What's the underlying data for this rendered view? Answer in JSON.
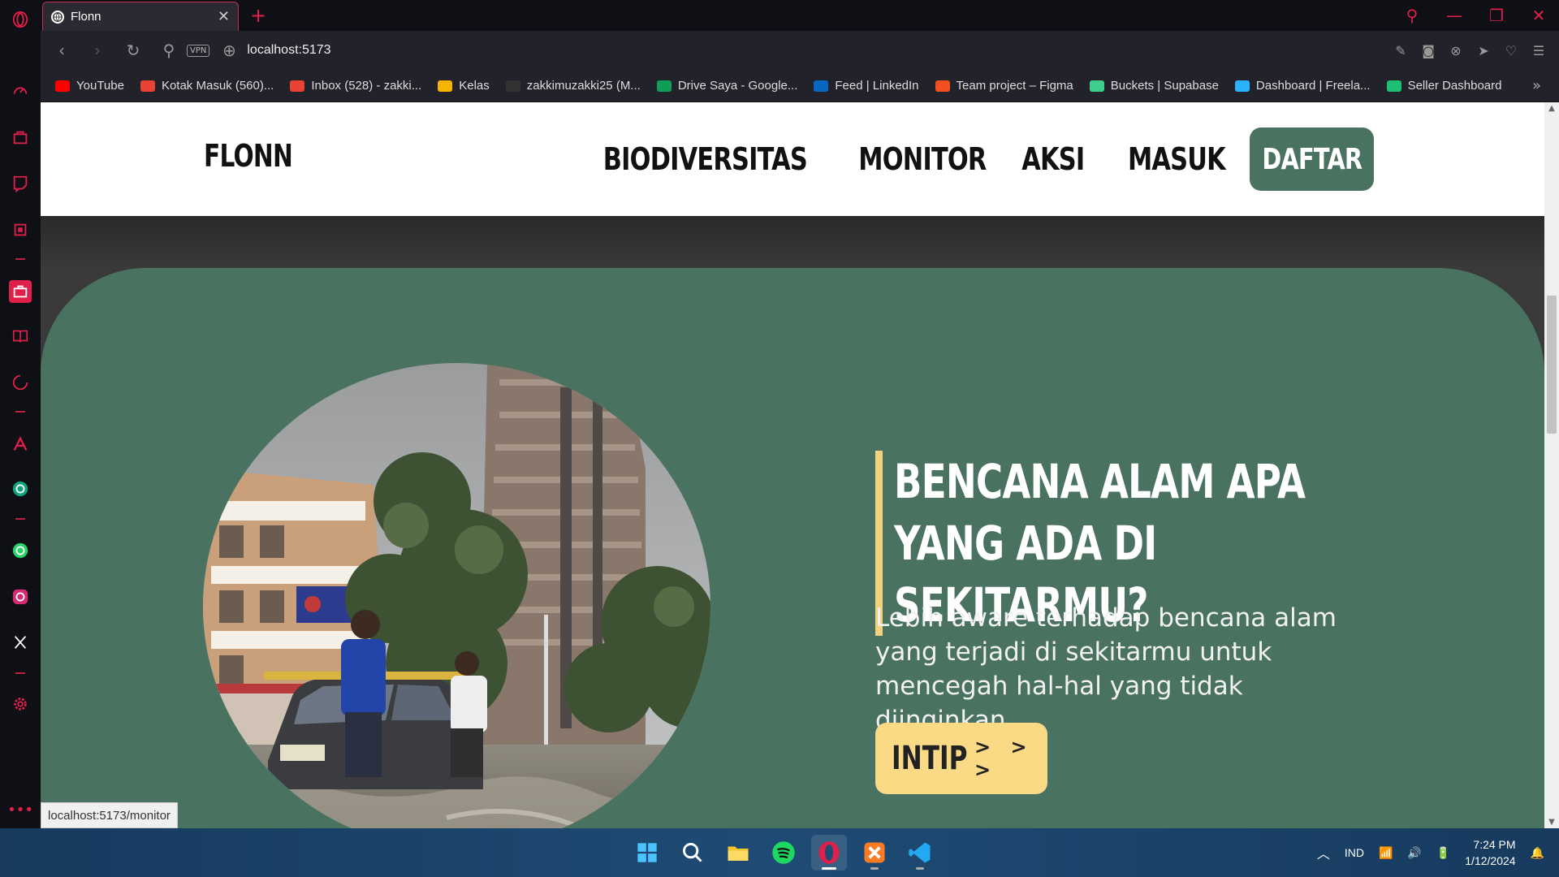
{
  "browser": {
    "tab_title": "Flonn",
    "url": "localhost:5173",
    "vpn_badge": "VPN",
    "status_url": "localhost:5173/monitor",
    "accent_color": "#e0204a"
  },
  "bookmarks": [
    {
      "label": "YouTube",
      "icon": "youtube-icon",
      "color": "#ff0000"
    },
    {
      "label": "Kotak Masuk (560)...",
      "icon": "gmail-icon",
      "color": "#ea4335"
    },
    {
      "label": "Inbox (528) - zakki...",
      "icon": "gmail-icon",
      "color": "#ea4335"
    },
    {
      "label": "Kelas",
      "icon": "classroom-icon",
      "color": "#f4b400"
    },
    {
      "label": "zakkimuzakki25 (M...",
      "icon": "github-icon",
      "color": "#333333"
    },
    {
      "label": "Drive Saya - Google...",
      "icon": "drive-icon",
      "color": "#0f9d58"
    },
    {
      "label": "Feed | LinkedIn",
      "icon": "linkedin-icon",
      "color": "#0a66c2"
    },
    {
      "label": "Team project – Figma",
      "icon": "figma-icon",
      "color": "#f24e1e"
    },
    {
      "label": "Buckets | Supabase",
      "icon": "supabase-icon",
      "color": "#3ecf8e"
    },
    {
      "label": "Dashboard | Freela...",
      "icon": "freelancer-icon",
      "color": "#29b2fe"
    },
    {
      "label": "Seller Dashboard",
      "icon": "fiverr-icon",
      "color": "#1dbf73"
    }
  ],
  "site": {
    "logo": "FLONN",
    "nav": [
      "BIODIVERSITAS",
      "MONITOR",
      "AKSI",
      "MASUK"
    ],
    "register_button": "DAFTAR",
    "brand_green": "#4a7261",
    "accent_yellow": "#fbda86"
  },
  "hero": {
    "headline": "BENCANA ALAM APA YANG ADA DI SEKITARMU?",
    "subtext": "Lebih aware terhadap bencana alam yang terjadi di sekitarmu untuk mencegah hal-hal yang tidak diinginkan.",
    "cta_label": "INTIP",
    "cta_arrows": "> > >",
    "image_alt": "flood-photo"
  },
  "taskbar": {
    "language": "IND",
    "time": "7:24 PM",
    "date": "1/12/2024",
    "apps": [
      "start-icon",
      "search-icon",
      "file-explorer-icon",
      "spotify-icon",
      "opera-icon",
      "xampp-icon",
      "vscode-icon"
    ]
  }
}
